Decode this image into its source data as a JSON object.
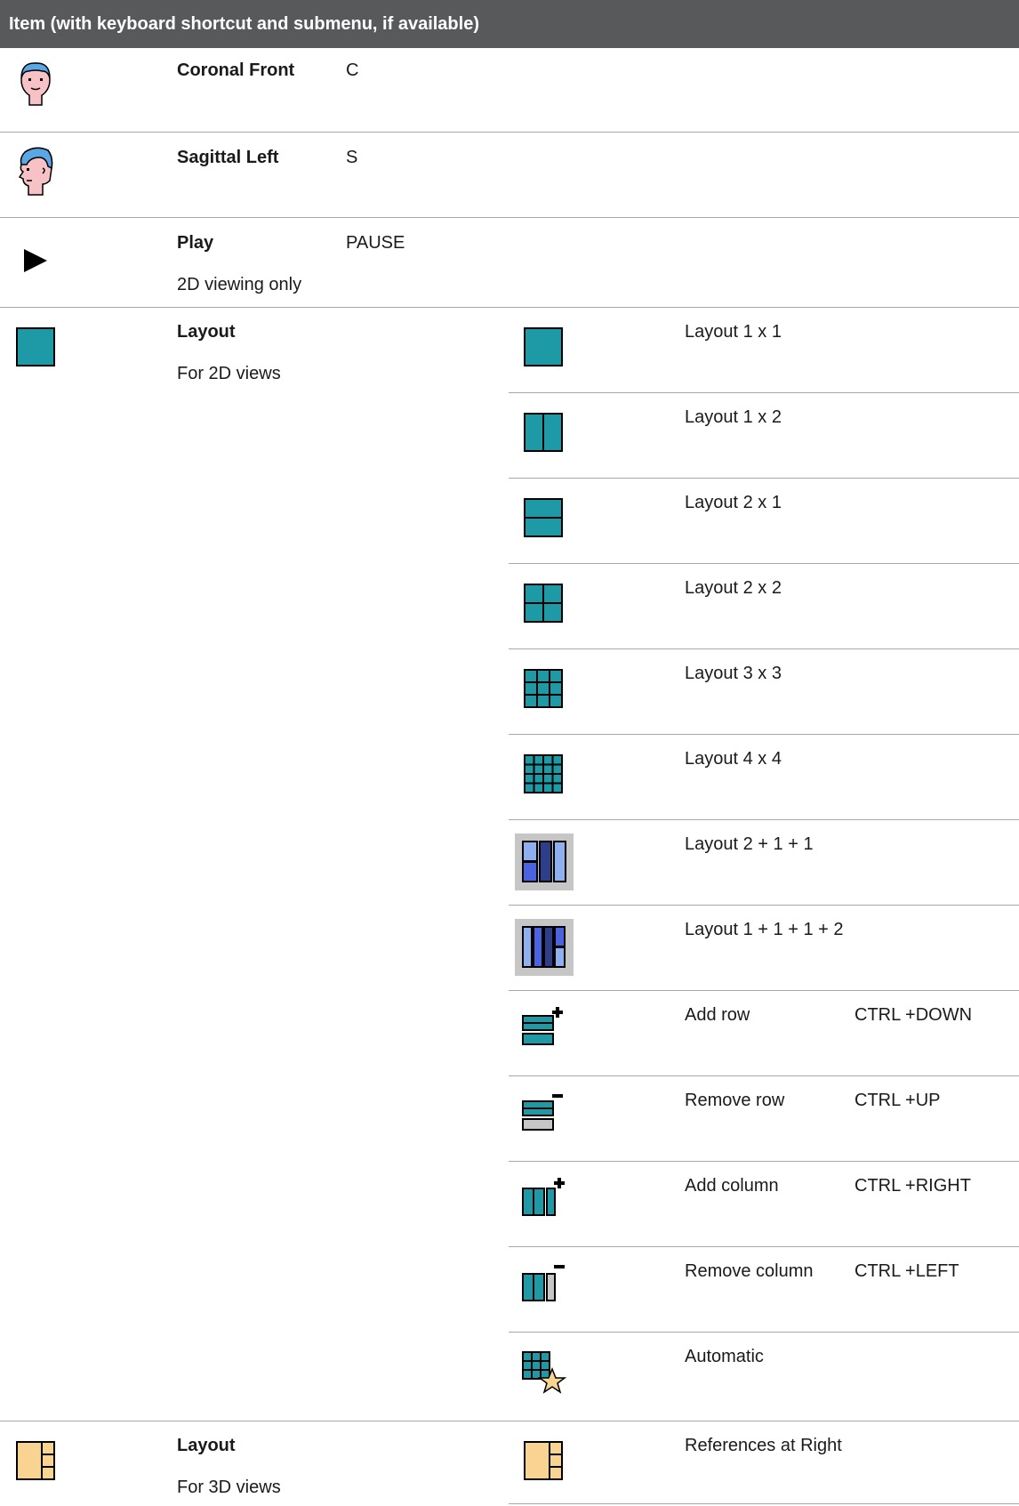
{
  "header": {
    "title": "Item (with keyboard shortcut and submenu, if available)"
  },
  "rows": [
    {
      "icon": "coronal-face-icon",
      "label": "Coronal Front",
      "shortcut": "C"
    },
    {
      "icon": "sagittal-face-icon",
      "label": "Sagittal Left",
      "shortcut": "S"
    },
    {
      "icon": "play-icon",
      "label": "Play",
      "shortcut": "PAUSE",
      "note": "2D viewing only"
    },
    {
      "icon": "layout-1x1-icon",
      "label": "Layout",
      "note": "For 2D views"
    },
    {
      "icon": "layout-references-right-icon",
      "label": "Layout",
      "note": "For 3D views"
    }
  ],
  "submenu_2d": [
    {
      "icon": "layout-1x1-icon",
      "label": "Layout 1 x 1"
    },
    {
      "icon": "layout-1x2-icon",
      "label": "Layout 1 x 2"
    },
    {
      "icon": "layout-2x1-icon",
      "label": "Layout 2 x 1"
    },
    {
      "icon": "layout-2x2-icon",
      "label": "Layout 2 x 2"
    },
    {
      "icon": "layout-3x3-icon",
      "label": "Layout 3 x 3"
    },
    {
      "icon": "layout-4x4-icon",
      "label": "Layout 4 x 4"
    },
    {
      "icon": "layout-2-1-1-icon",
      "label": "Layout 2 + 1 + 1"
    },
    {
      "icon": "layout-1-1-1-2-icon",
      "label": "Layout 1 + 1 + 1 + 2"
    },
    {
      "icon": "add-row-icon",
      "label": "Add row",
      "shortcut": "CTRL +DOWN"
    },
    {
      "icon": "remove-row-icon",
      "label": "Remove row",
      "shortcut": "CTRL +UP"
    },
    {
      "icon": "add-column-icon",
      "label": "Add column",
      "shortcut": "CTRL +RIGHT"
    },
    {
      "icon": "remove-column-icon",
      "label": "Remove column",
      "shortcut": "CTRL +LEFT"
    },
    {
      "icon": "automatic-layout-icon",
      "label": "Automatic"
    }
  ],
  "submenu_3d": [
    {
      "icon": "layout-references-right-icon",
      "label": "References at Right"
    }
  ],
  "colors": {
    "header": "#58595b",
    "teal": "#1e9aa6",
    "divider": "#a7a9ac",
    "blue": "#5b78e8",
    "tan": "#f8d391"
  }
}
